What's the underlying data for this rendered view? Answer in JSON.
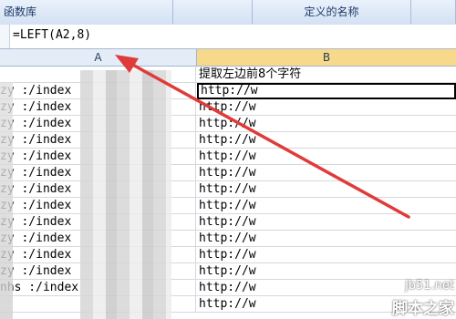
{
  "ribbon": {
    "group1_label": "函数库",
    "group2_label": "定义的名称"
  },
  "formula_bar": {
    "formula": "=LEFT(A2,8)"
  },
  "columns": {
    "a": "A",
    "b": "B"
  },
  "rows": [
    {
      "a": "",
      "b": "提取左边前8个字符"
    },
    {
      "a": "zy :/index",
      "b": "http://w"
    },
    {
      "a": "zy :/index",
      "b": "http://w"
    },
    {
      "a": "zy :/index",
      "b": "http://w"
    },
    {
      "a": "zy :/index",
      "b": "http://w"
    },
    {
      "a": "zy :/index",
      "b": "http://w"
    },
    {
      "a": "zy :/index",
      "b": "http://w"
    },
    {
      "a": "zy :/index",
      "b": "http://w"
    },
    {
      "a": "zy :/index",
      "b": "http://w"
    },
    {
      "a": "zy :/index",
      "b": "http://w"
    },
    {
      "a": "zy :/index",
      "b": "http://w"
    },
    {
      "a": "zy :/index",
      "b": "http://w"
    },
    {
      "a": "zy :/index",
      "b": "http://w"
    },
    {
      "a": "nhs :/index",
      "b": "http://w"
    },
    {
      "a": "",
      "b": "http://w"
    }
  ],
  "watermark": {
    "site": "jb51.net",
    "name": "脚本之家"
  },
  "colors": {
    "arrow": "#e03b3b",
    "selected_header": "#f6d98a"
  }
}
